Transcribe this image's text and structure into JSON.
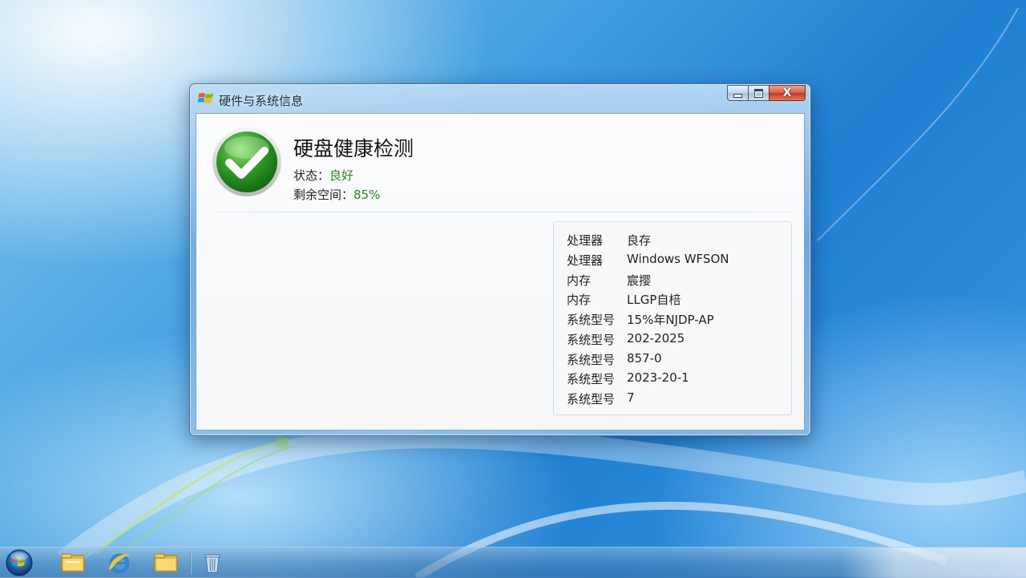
{
  "window": {
    "title": "硬件与系统信息",
    "controls": {
      "minimize": "minimize",
      "maximize": "maximize",
      "close": "X"
    }
  },
  "summary": {
    "heading": "硬盘健康检测",
    "status_label": "状态：",
    "status_value": "良好",
    "space_label": "剩余空间：",
    "space_value": "85%",
    "status_icon": "green-checkmark-icon"
  },
  "info_rows": [
    {
      "key": "处理器",
      "value": "良存"
    },
    {
      "key": "处理器",
      "value": "Windows WFSON"
    },
    {
      "key": "内存",
      "value": "宸撄"
    },
    {
      "key": "内存",
      "value": "LLGP自棓"
    },
    {
      "key": "系统型号",
      "value": "15%年NJDP-AP"
    },
    {
      "key": "系统型号",
      "value": "202-2025"
    },
    {
      "key": "系统型号",
      "value": "857-0"
    },
    {
      "key": "系统型号",
      "value": "2023-20-1"
    },
    {
      "key": "系统型号",
      "value": "7"
    }
  ],
  "taskbar": {
    "items": [
      "start-orb",
      "folder-icon",
      "internet-explorer-icon",
      "folder-icon",
      "recycle-bin-icon"
    ]
  },
  "colors": {
    "status_good": "#2a8a1e",
    "close_button": "#c1391f",
    "desktop": "#2f8bd9"
  }
}
